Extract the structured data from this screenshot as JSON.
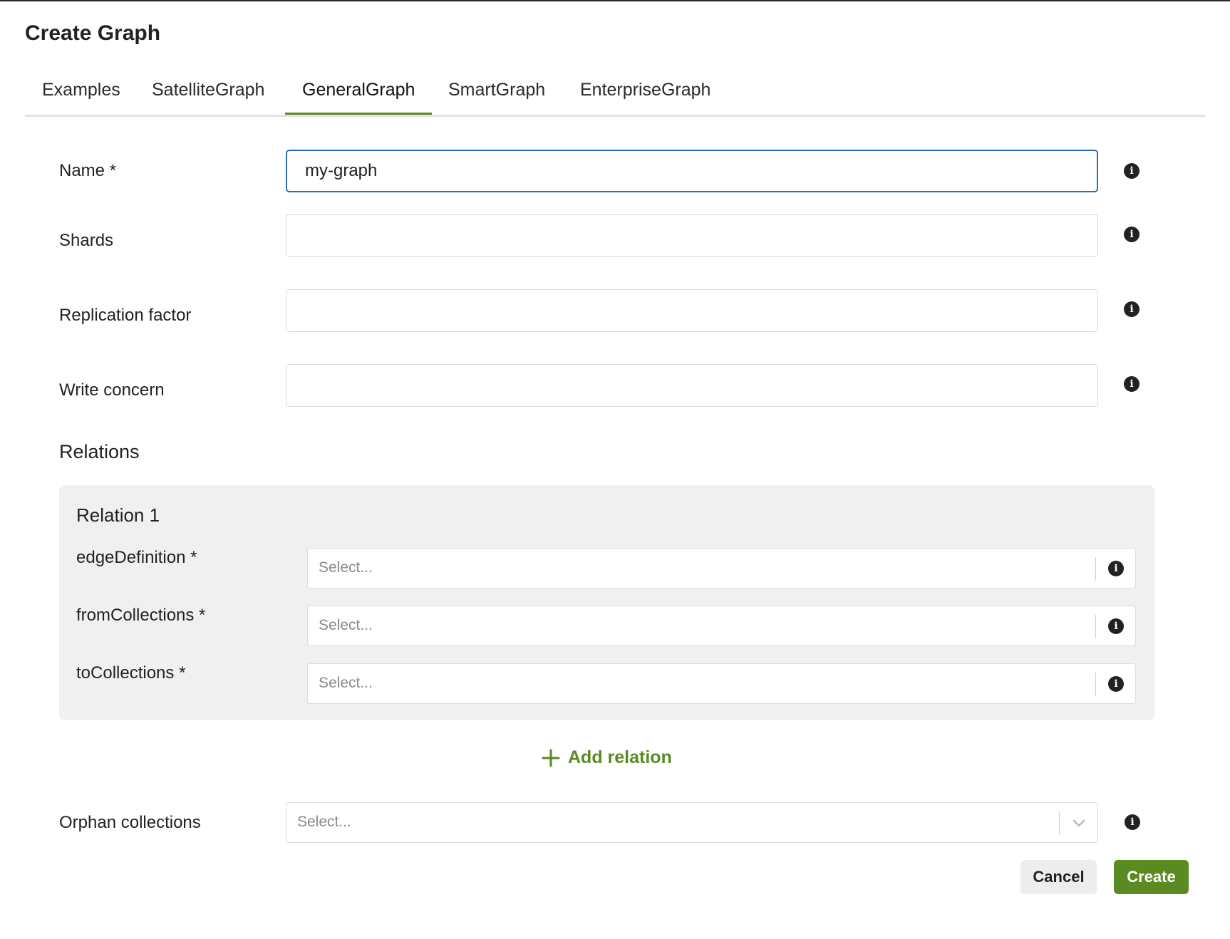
{
  "dialog": {
    "title": "Create Graph"
  },
  "tabs": [
    {
      "label": "Examples"
    },
    {
      "label": "SatelliteGraph"
    },
    {
      "label": "GeneralGraph",
      "active": true
    },
    {
      "label": "SmartGraph"
    },
    {
      "label": "EnterpriseGraph"
    }
  ],
  "form": {
    "name": {
      "label": "Name *",
      "value": "my-graph"
    },
    "shards": {
      "label": "Shards",
      "value": ""
    },
    "replication": {
      "label": "Replication factor",
      "value": ""
    },
    "write_concern": {
      "label": "Write concern",
      "value": ""
    }
  },
  "relations": {
    "section_title": "Relations",
    "items": [
      {
        "title": "Relation 1",
        "edge_definition": {
          "label": "edgeDefinition *",
          "placeholder": "Select..."
        },
        "from_collections": {
          "label": "fromCollections *",
          "placeholder": "Select..."
        },
        "to_collections": {
          "label": "toCollections *",
          "placeholder": "Select..."
        }
      }
    ],
    "add_label": "Add relation"
  },
  "orphans": {
    "label": "Orphan collections",
    "placeholder": "Select..."
  },
  "actions": {
    "cancel_label": "Cancel",
    "create_label": "Create"
  },
  "colors": {
    "accent": "#5a8a22",
    "focus": "#2a6fb5",
    "panel": "#f0f0f0"
  },
  "icons": {
    "info": "info-circle-icon",
    "chevron": "chevron-down-icon",
    "add": "plus-icon"
  }
}
